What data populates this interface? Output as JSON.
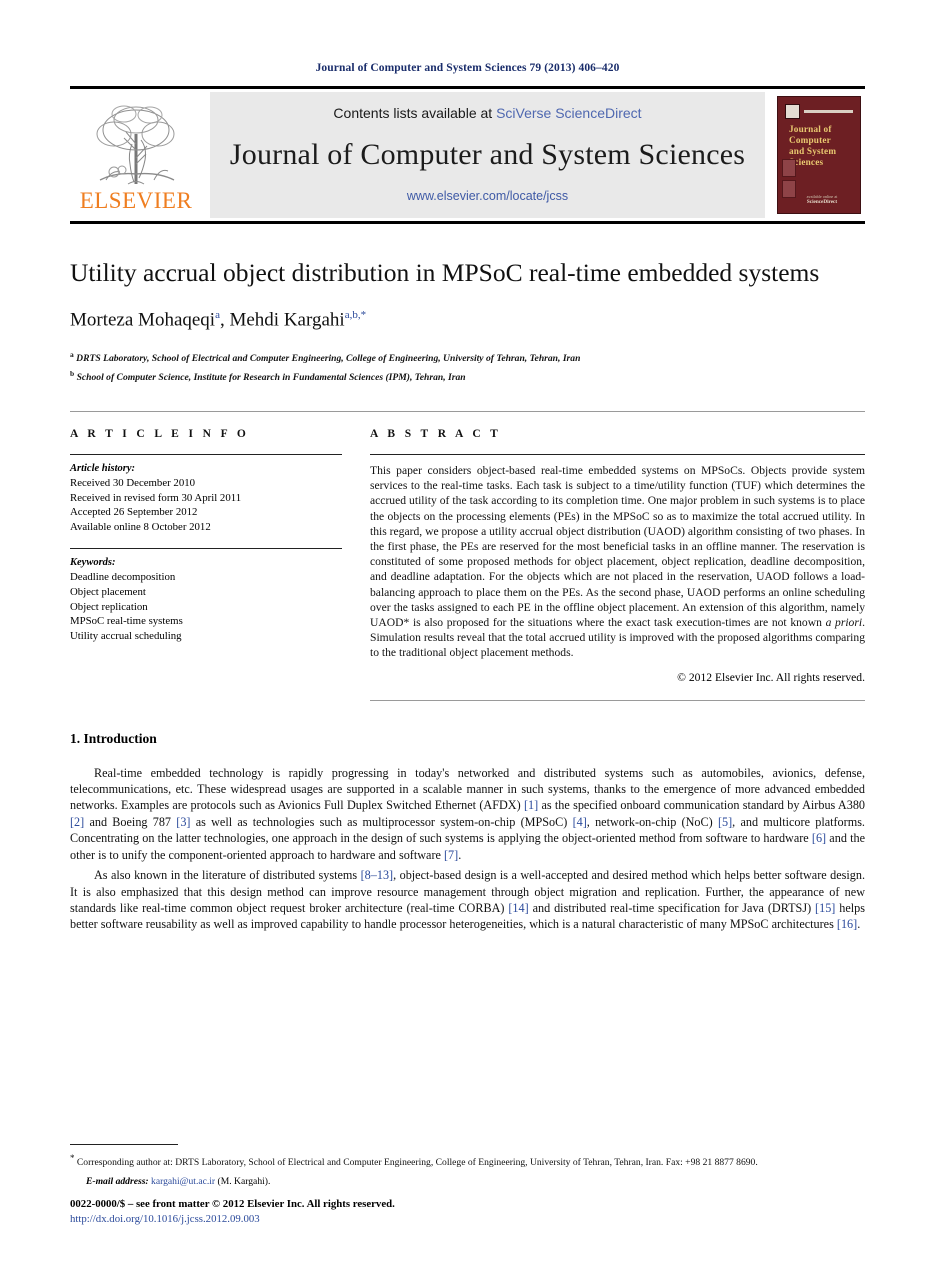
{
  "running_head": "Journal of Computer and System Sciences 79 (2013) 406–420",
  "masthead": {
    "contents_prefix": "Contents lists available at ",
    "contents_link": "SciVerse ScienceDirect",
    "journal_name": "Journal of Computer and System Sciences",
    "journal_url": "www.elsevier.com/locate/jcss",
    "publisher_wordmark": "ELSEVIER",
    "cover": {
      "line1": "Journal of",
      "line2": "Computer",
      "line3": "and System",
      "line4": "Sciences",
      "bottom_small": "available online at",
      "bottom_brand": "ScienceDirect"
    },
    "colors": {
      "elsevier_orange": "#ef7e20",
      "link_blue": "#4f68b0",
      "cover_maroon": "#6d1f23",
      "cover_gold": "#e8c870"
    }
  },
  "article": {
    "title": "Utility accrual object distribution in MPSoC real-time embedded systems",
    "authors_plain": "Morteza Mohaqeqi a, Mehdi Kargahi a,b,*",
    "author1": "Morteza Mohaqeqi",
    "author1_sup": "a",
    "author2": "Mehdi Kargahi",
    "author2_sup": "a,b,",
    "author2_star": "*",
    "affiliation_a_marker": "a",
    "affiliation_a": "DRTS Laboratory, School of Electrical and Computer Engineering, College of Engineering, University of Tehran, Tehran, Iran",
    "affiliation_b_marker": "b",
    "affiliation_b": "School of Computer Science, Institute for Research in Fundamental Sciences (IPM), Tehran, Iran"
  },
  "article_info": {
    "heading": "A R T I C L E   I N F O",
    "history_label": "Article history:",
    "history": [
      "Received 30 December 2010",
      "Received in revised form 30 April 2011",
      "Accepted 26 September 2012",
      "Available online 8 October 2012"
    ],
    "keywords_label": "Keywords:",
    "keywords": [
      "Deadline decomposition",
      "Object placement",
      "Object replication",
      "MPSoC real-time systems",
      "Utility accrual scheduling"
    ]
  },
  "abstract": {
    "heading": "A B S T R A C T",
    "text_1": "This paper considers object-based real-time embedded systems on MPSoCs. Objects provide system services to the real-time tasks. Each task is subject to a time/utility function (TUF) which determines the accrued utility of the task according to its completion time. One major problem in such systems is to place the objects on the processing elements (PEs) in the MPSoC so as to maximize the total accrued utility. In this regard, we propose a utility accrual object distribution (UAOD) algorithm consisting of two phases. In the first phase, the PEs are reserved for the most beneficial tasks in an offline manner. The reservation is constituted of some proposed methods for object placement, object replication, deadline decomposition, and deadline adaptation. For the objects which are not placed in the reservation, UAOD follows a load-balancing approach to place them on the PEs. As the second phase, UAOD performs an online scheduling over the tasks assigned to each PE in the offline object placement. An extension of this algorithm, namely UAOD* is also proposed for the situations where the exact task execution-times are not known ",
    "text_italic": "a priori",
    "text_2": ". Simulation results reveal that the total accrued utility is improved with the proposed algorithms comparing to the traditional object placement methods.",
    "copyright": "© 2012 Elsevier Inc. All rights reserved."
  },
  "body": {
    "section_number_title": "1. Introduction",
    "paragraph_1_parts": [
      "Real-time embedded technology is rapidly progressing in today's networked and distributed systems such as automobiles, avionics, defense, telecommunications, etc. These widespread usages are supported in a scalable manner in such systems, thanks to the emergence of more advanced embedded networks. Examples are protocols such as Avionics Full Duplex Switched Ethernet (AFDX) ",
      "[1]",
      " as the specified onboard communication standard by Airbus A380 ",
      "[2]",
      " and Boeing 787 ",
      "[3]",
      " as well as technologies such as multiprocessor system-on-chip (MPSoC) ",
      "[4]",
      ", network-on-chip (NoC) ",
      "[5]",
      ", and multicore platforms. Concentrating on the latter technologies, one approach in the design of such systems is applying the object-oriented method from software to hardware ",
      "[6]",
      " and the other is to unify the component-oriented approach to hardware and software ",
      "[7]",
      "."
    ],
    "paragraph_2_parts": [
      "As also known in the literature of distributed systems ",
      "[8–13]",
      ", object-based design is a well-accepted and desired method which helps better software design. It is also emphasized that this design method can improve resource management through object migration and replication. Further, the appearance of new standards like real-time common object request broker architecture (real-time CORBA) ",
      "[14]",
      " and distributed real-time specification for Java (DRTSJ) ",
      "[15]",
      " helps better software reusability as well as improved capability to handle processor heterogeneities, which is a natural characteristic of many MPSoC architectures ",
      "[16]",
      "."
    ]
  },
  "footnotes": {
    "corresponding_star": "*",
    "corresponding_text": "Corresponding author at: DRTS Laboratory, School of Electrical and Computer Engineering, College of Engineering, University of Tehran, Tehran, Iran. Fax: +98 21 8877 8690.",
    "email_label": "E-mail address:",
    "email_address": "kargahi@ut.ac.ir",
    "email_suffix": "(M. Kargahi)."
  },
  "imprint": {
    "issn_line": "0022-0000/$ – see front matter  © 2012 Elsevier Inc. All rights reserved.",
    "doi": "http://dx.doi.org/10.1016/j.jcss.2012.09.003"
  }
}
